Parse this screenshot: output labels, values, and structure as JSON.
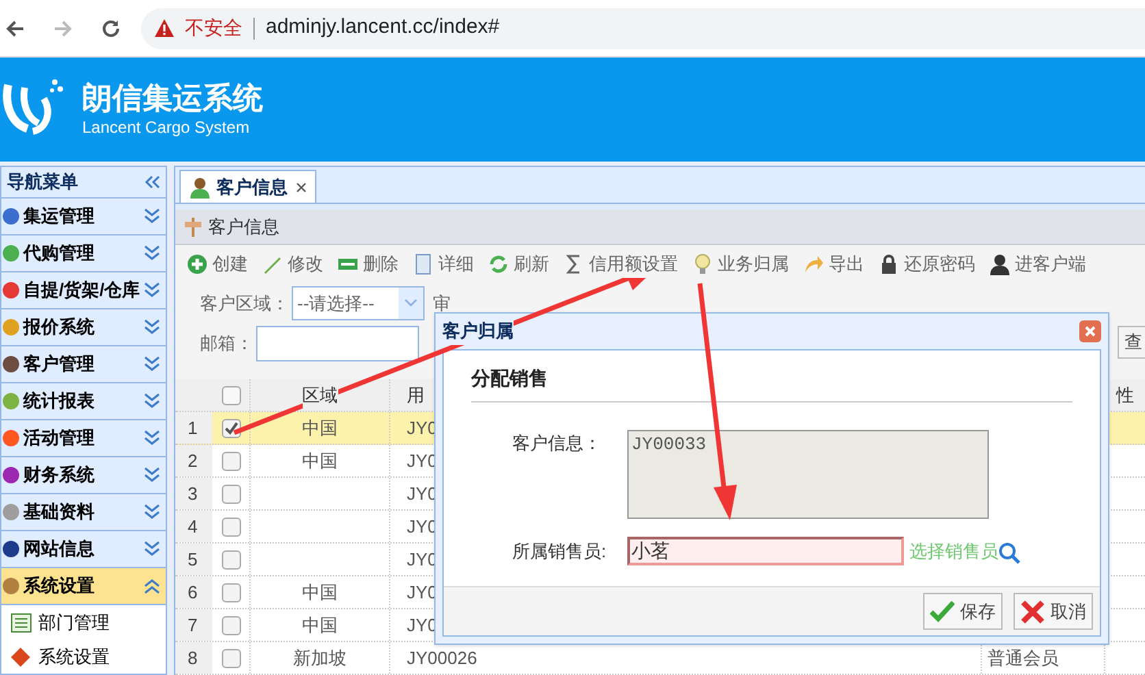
{
  "browser": {
    "security": "不安全",
    "url": "adminjy.lancent.cc/index#"
  },
  "header": {
    "title": "朗信集运系统",
    "subtitle": "Lancent Cargo System"
  },
  "sidebar": {
    "title": "导航菜单",
    "items": [
      {
        "label": "集运管理",
        "expanded": false,
        "selected": false
      },
      {
        "label": "代购管理",
        "expanded": false,
        "selected": false
      },
      {
        "label": "自提/货架/仓库",
        "expanded": false,
        "selected": false
      },
      {
        "label": "报价系统",
        "expanded": false,
        "selected": false
      },
      {
        "label": "客户管理",
        "expanded": false,
        "selected": false
      },
      {
        "label": "统计报表",
        "expanded": false,
        "selected": false
      },
      {
        "label": "活动管理",
        "expanded": false,
        "selected": false
      },
      {
        "label": "财务系统",
        "expanded": false,
        "selected": false
      },
      {
        "label": "基础资料",
        "expanded": false,
        "selected": false
      },
      {
        "label": "网站信息",
        "expanded": false,
        "selected": false
      },
      {
        "label": "系统设置",
        "expanded": true,
        "selected": true,
        "children": [
          {
            "label": "部门管理"
          },
          {
            "label": "系统设置"
          }
        ]
      }
    ]
  },
  "tabs": [
    {
      "label": "客户信息",
      "selected": true
    }
  ],
  "panel_title": "客户信息",
  "toolbar": [
    "创建",
    "修改",
    "删除",
    "详细",
    "刷新",
    "信用额设置",
    "业务归属",
    "导出",
    "还原密码",
    "进客户端"
  ],
  "filters": [
    [
      {
        "kind": "label",
        "text": "客户区域："
      },
      {
        "kind": "select",
        "value": "--请选择--"
      },
      {
        "kind": "label",
        "text": "审"
      }
    ],
    [
      {
        "kind": "label",
        "text": "邮箱："
      },
      {
        "kind": "input"
      }
    ]
  ],
  "search_button": "查",
  "table": {
    "columns": [
      "区域",
      "用",
      "性"
    ],
    "all_checked": false,
    "rows": [
      {
        "number": "1",
        "checked": true,
        "selected": true,
        "region": "中国",
        "user": "JY0"
      },
      {
        "number": "2",
        "checked": false,
        "selected": false,
        "region": "中国",
        "user": "JY0"
      },
      {
        "number": "3",
        "checked": false,
        "selected": false,
        "user": "JY0"
      },
      {
        "number": "4",
        "checked": false,
        "selected": false,
        "user": "JY0"
      },
      {
        "number": "5",
        "checked": false,
        "selected": false,
        "user": "JY0"
      },
      {
        "number": "6",
        "checked": false,
        "selected": false,
        "region": "中国",
        "user": "JY0"
      },
      {
        "number": "7",
        "checked": false,
        "selected": false,
        "region": "中国",
        "user": "JY0"
      },
      {
        "number": "8",
        "checked": false,
        "selected": false,
        "region": "新加坡",
        "user": "JY00026",
        "level": "普通会员"
      }
    ]
  },
  "dialog": {
    "title": "客户归属",
    "heading": "分配销售",
    "fields": [
      {
        "kind": "textarea",
        "label": "客户信息：",
        "value": "JY00033",
        "disabled": true
      },
      {
        "kind": "input",
        "label": "所属销售员:",
        "value": "小茗",
        "invalid": true
      }
    ],
    "link": "选择销售员",
    "buttons": [
      {
        "kind": "save",
        "label": "保存"
      },
      {
        "kind": "cancel",
        "label": "取消"
      }
    ]
  }
}
